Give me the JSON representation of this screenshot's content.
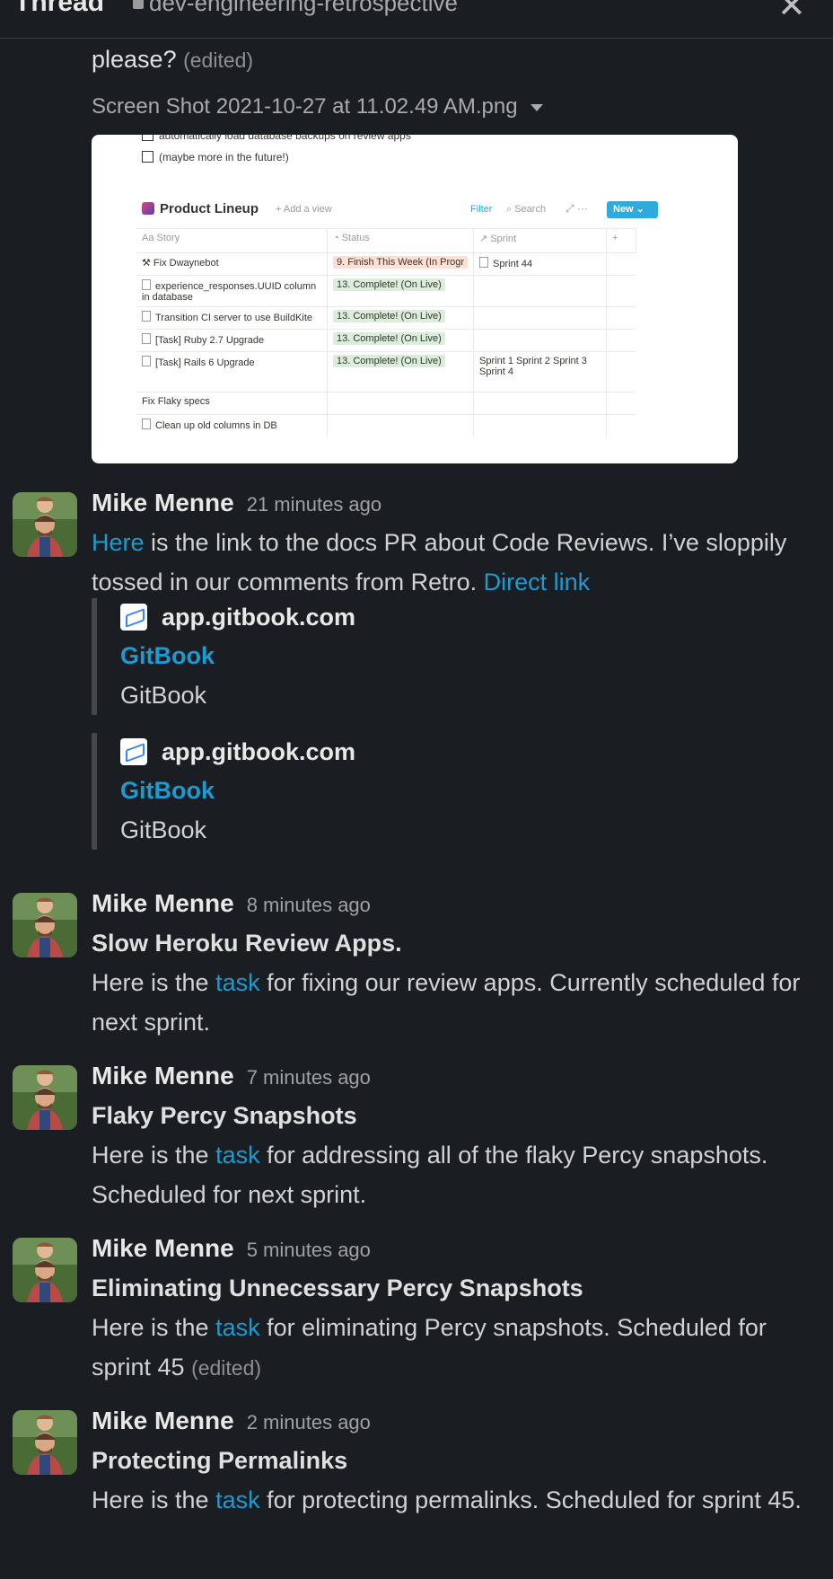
{
  "header": {
    "title": "Thread",
    "channel": "dev-engineering-retrospective"
  },
  "top": {
    "continuation": "please?",
    "edited": "(edited)",
    "file_name": "Screen Shot 2021-10-27 at 11.02.49 AM.png"
  },
  "screenshot": {
    "line1": "automatically load database backups on review apps",
    "line2": "(maybe more in the future!)",
    "db_title": "Product Lineup",
    "add_view": "+ Add a view",
    "filter": "Filter",
    "search": "Search",
    "new_button": "New",
    "columns": [
      "Story",
      "Status",
      "Sprint"
    ],
    "rows": [
      {
        "story": "Fix Dwaynebot",
        "status": "9. Finish This Week (In Progr",
        "sprint": "Sprint 44",
        "status_color": "red"
      },
      {
        "story": "experience_responses.UUID column in database",
        "status": "13. Complete! (On Live)",
        "sprint": "",
        "status_color": "green"
      },
      {
        "story": "Transition CI server to use BuildKite",
        "status": "13. Complete! (On Live)",
        "sprint": "",
        "status_color": "green"
      },
      {
        "story": "[Task] Ruby 2.7 Upgrade",
        "status": "13. Complete! (On Live)",
        "sprint": "",
        "status_color": "green"
      },
      {
        "story": "[Task] Rails 6 Upgrade",
        "status": "13. Complete! (On Live)",
        "sprint": "Sprint 1  Sprint 2  Sprint 3  Sprint 4",
        "status_color": "green"
      },
      {
        "story": "Fix Flaky specs",
        "status": "",
        "sprint": "",
        "status_color": ""
      },
      {
        "story": "Clean up old columns in DB",
        "status": "",
        "sprint": "",
        "status_color": ""
      }
    ]
  },
  "messages": [
    {
      "author": "Mike Menne",
      "time": "21 minutes ago",
      "link1": "Here",
      "text1": " is the link to the docs PR about Code Reviews.  I’ve sloppily tossed in our comments from Retro.  ",
      "link2": "Direct link",
      "unfurls": [
        {
          "site": "app.gitbook.com",
          "title": "GitBook",
          "desc": "GitBook"
        },
        {
          "site": "app.gitbook.com",
          "title": "GitBook",
          "desc": "GitBook"
        }
      ]
    },
    {
      "author": "Mike Menne",
      "time": "8 minutes ago",
      "heading": "Slow Heroku Review Apps.",
      "pre": "Here is the ",
      "link": "task",
      "post": " for fixing our review apps.  Currently scheduled for next sprint."
    },
    {
      "author": "Mike Menne",
      "time": "7 minutes ago",
      "heading": "Flaky Percy Snapshots",
      "pre": "Here is the ",
      "link": "task",
      "post": " for addressing all of the flaky Percy snapshots.  Scheduled for next sprint."
    },
    {
      "author": "Mike Menne",
      "time": "5 minutes ago",
      "heading": "Eliminating Unnecessary Percy Snapshots",
      "pre": "Here is the ",
      "link": "task",
      "post": " for eliminating Percy snapshots.  Scheduled for sprint 45 ",
      "edited": "(edited)"
    },
    {
      "author": "Mike Menne",
      "time": "2 minutes ago",
      "heading": "Protecting Permalinks",
      "pre": "Here is the ",
      "link": "task",
      "post": " for protecting permalinks.  Scheduled for sprint 45."
    }
  ]
}
